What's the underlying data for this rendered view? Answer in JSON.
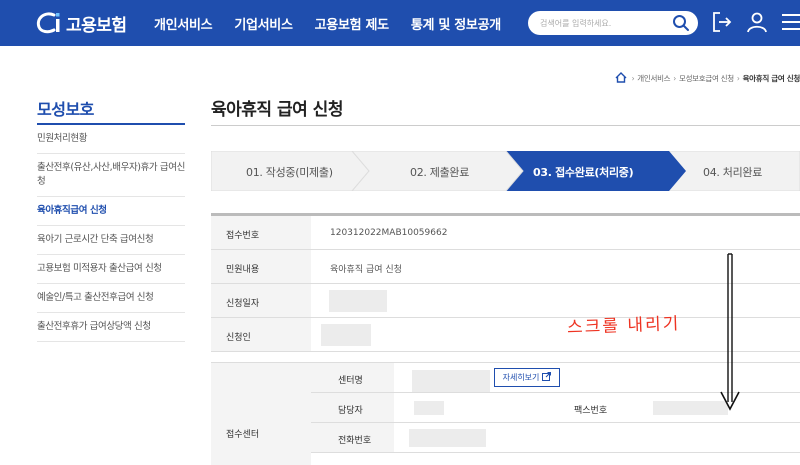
{
  "header": {
    "logo_text": "고용보험",
    "nav": [
      "개인서비스",
      "기업서비스",
      "고용보험 제도",
      "통계 및 정보공개"
    ],
    "search_placeholder": "검색어를 입력하세요."
  },
  "breadcrumb": [
    "개인서비스",
    "모성보호급여 신청",
    "육아휴직 급여 신청"
  ],
  "sidebar": {
    "title": "모성보호",
    "items": [
      {
        "label": "민원처리현황"
      },
      {
        "label": "출산전후(유산,사산,배우자)휴가 급여신청"
      },
      {
        "label": "육아휴직급여 신청"
      },
      {
        "label": "육아기 근로시간 단축 급여신청"
      },
      {
        "label": "고용보험 미적용자 출산급여 신청"
      },
      {
        "label": "예술인/특고 출산전후급여 신청"
      },
      {
        "label": "출산전후휴가 급여상당액 신청"
      }
    ],
    "active_index": 2
  },
  "main": {
    "title": "육아휴직 급여 신청",
    "steps": [
      {
        "label": "01. 작성중(미제출)"
      },
      {
        "label": "02. 제출완료"
      },
      {
        "label": "03. 접수완료(처리중)"
      },
      {
        "label": "04. 처리완료"
      }
    ],
    "active_step": 2,
    "rows": [
      {
        "key": "접수번호",
        "value": "120312022MAB10059662"
      },
      {
        "key": "민원내용",
        "value": "육아휴직 급여 신청"
      },
      {
        "key": "신청일자",
        "value": ""
      },
      {
        "key": "신청인",
        "value": ""
      }
    ],
    "center": {
      "key": "접수센터",
      "center_name_key": "센터명",
      "detail_button": "자세히보기",
      "manager_key": "담당자",
      "fax_key": "팩스번호",
      "phone_key": "전화번호"
    }
  },
  "annotation": "스크롤 내리기",
  "colors": {
    "brand": "#1f4eae",
    "annotation": "#ee3322",
    "step_inactive": "#f2f2f2"
  }
}
